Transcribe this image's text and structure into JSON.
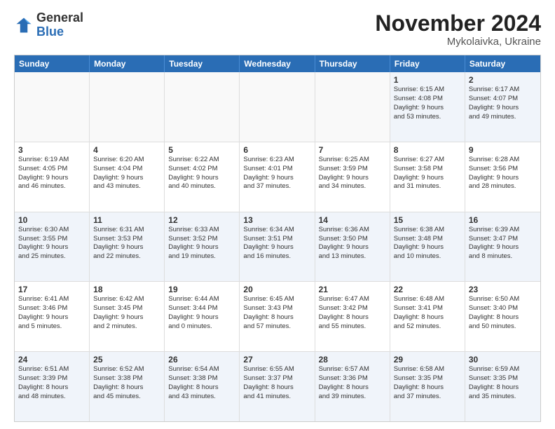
{
  "header": {
    "logo_general": "General",
    "logo_blue": "Blue",
    "month_title": "November 2024",
    "subtitle": "Mykolaivka, Ukraine"
  },
  "days": [
    "Sunday",
    "Monday",
    "Tuesday",
    "Wednesday",
    "Thursday",
    "Friday",
    "Saturday"
  ],
  "rows": [
    [
      {
        "day": "",
        "info": ""
      },
      {
        "day": "",
        "info": ""
      },
      {
        "day": "",
        "info": ""
      },
      {
        "day": "",
        "info": ""
      },
      {
        "day": "",
        "info": ""
      },
      {
        "day": "1",
        "info": "Sunrise: 6:15 AM\nSunset: 4:08 PM\nDaylight: 9 hours\nand 53 minutes."
      },
      {
        "day": "2",
        "info": "Sunrise: 6:17 AM\nSunset: 4:07 PM\nDaylight: 9 hours\nand 49 minutes."
      }
    ],
    [
      {
        "day": "3",
        "info": "Sunrise: 6:19 AM\nSunset: 4:05 PM\nDaylight: 9 hours\nand 46 minutes."
      },
      {
        "day": "4",
        "info": "Sunrise: 6:20 AM\nSunset: 4:04 PM\nDaylight: 9 hours\nand 43 minutes."
      },
      {
        "day": "5",
        "info": "Sunrise: 6:22 AM\nSunset: 4:02 PM\nDaylight: 9 hours\nand 40 minutes."
      },
      {
        "day": "6",
        "info": "Sunrise: 6:23 AM\nSunset: 4:01 PM\nDaylight: 9 hours\nand 37 minutes."
      },
      {
        "day": "7",
        "info": "Sunrise: 6:25 AM\nSunset: 3:59 PM\nDaylight: 9 hours\nand 34 minutes."
      },
      {
        "day": "8",
        "info": "Sunrise: 6:27 AM\nSunset: 3:58 PM\nDaylight: 9 hours\nand 31 minutes."
      },
      {
        "day": "9",
        "info": "Sunrise: 6:28 AM\nSunset: 3:56 PM\nDaylight: 9 hours\nand 28 minutes."
      }
    ],
    [
      {
        "day": "10",
        "info": "Sunrise: 6:30 AM\nSunset: 3:55 PM\nDaylight: 9 hours\nand 25 minutes."
      },
      {
        "day": "11",
        "info": "Sunrise: 6:31 AM\nSunset: 3:53 PM\nDaylight: 9 hours\nand 22 minutes."
      },
      {
        "day": "12",
        "info": "Sunrise: 6:33 AM\nSunset: 3:52 PM\nDaylight: 9 hours\nand 19 minutes."
      },
      {
        "day": "13",
        "info": "Sunrise: 6:34 AM\nSunset: 3:51 PM\nDaylight: 9 hours\nand 16 minutes."
      },
      {
        "day": "14",
        "info": "Sunrise: 6:36 AM\nSunset: 3:50 PM\nDaylight: 9 hours\nand 13 minutes."
      },
      {
        "day": "15",
        "info": "Sunrise: 6:38 AM\nSunset: 3:48 PM\nDaylight: 9 hours\nand 10 minutes."
      },
      {
        "day": "16",
        "info": "Sunrise: 6:39 AM\nSunset: 3:47 PM\nDaylight: 9 hours\nand 8 minutes."
      }
    ],
    [
      {
        "day": "17",
        "info": "Sunrise: 6:41 AM\nSunset: 3:46 PM\nDaylight: 9 hours\nand 5 minutes."
      },
      {
        "day": "18",
        "info": "Sunrise: 6:42 AM\nSunset: 3:45 PM\nDaylight: 9 hours\nand 2 minutes."
      },
      {
        "day": "19",
        "info": "Sunrise: 6:44 AM\nSunset: 3:44 PM\nDaylight: 9 hours\nand 0 minutes."
      },
      {
        "day": "20",
        "info": "Sunrise: 6:45 AM\nSunset: 3:43 PM\nDaylight: 8 hours\nand 57 minutes."
      },
      {
        "day": "21",
        "info": "Sunrise: 6:47 AM\nSunset: 3:42 PM\nDaylight: 8 hours\nand 55 minutes."
      },
      {
        "day": "22",
        "info": "Sunrise: 6:48 AM\nSunset: 3:41 PM\nDaylight: 8 hours\nand 52 minutes."
      },
      {
        "day": "23",
        "info": "Sunrise: 6:50 AM\nSunset: 3:40 PM\nDaylight: 8 hours\nand 50 minutes."
      }
    ],
    [
      {
        "day": "24",
        "info": "Sunrise: 6:51 AM\nSunset: 3:39 PM\nDaylight: 8 hours\nand 48 minutes."
      },
      {
        "day": "25",
        "info": "Sunrise: 6:52 AM\nSunset: 3:38 PM\nDaylight: 8 hours\nand 45 minutes."
      },
      {
        "day": "26",
        "info": "Sunrise: 6:54 AM\nSunset: 3:38 PM\nDaylight: 8 hours\nand 43 minutes."
      },
      {
        "day": "27",
        "info": "Sunrise: 6:55 AM\nSunset: 3:37 PM\nDaylight: 8 hours\nand 41 minutes."
      },
      {
        "day": "28",
        "info": "Sunrise: 6:57 AM\nSunset: 3:36 PM\nDaylight: 8 hours\nand 39 minutes."
      },
      {
        "day": "29",
        "info": "Sunrise: 6:58 AM\nSunset: 3:35 PM\nDaylight: 8 hours\nand 37 minutes."
      },
      {
        "day": "30",
        "info": "Sunrise: 6:59 AM\nSunset: 3:35 PM\nDaylight: 8 hours\nand 35 minutes."
      }
    ]
  ],
  "alt_rows": [
    0,
    2,
    4
  ],
  "first_row_empty": [
    0,
    1,
    2,
    3,
    4
  ]
}
